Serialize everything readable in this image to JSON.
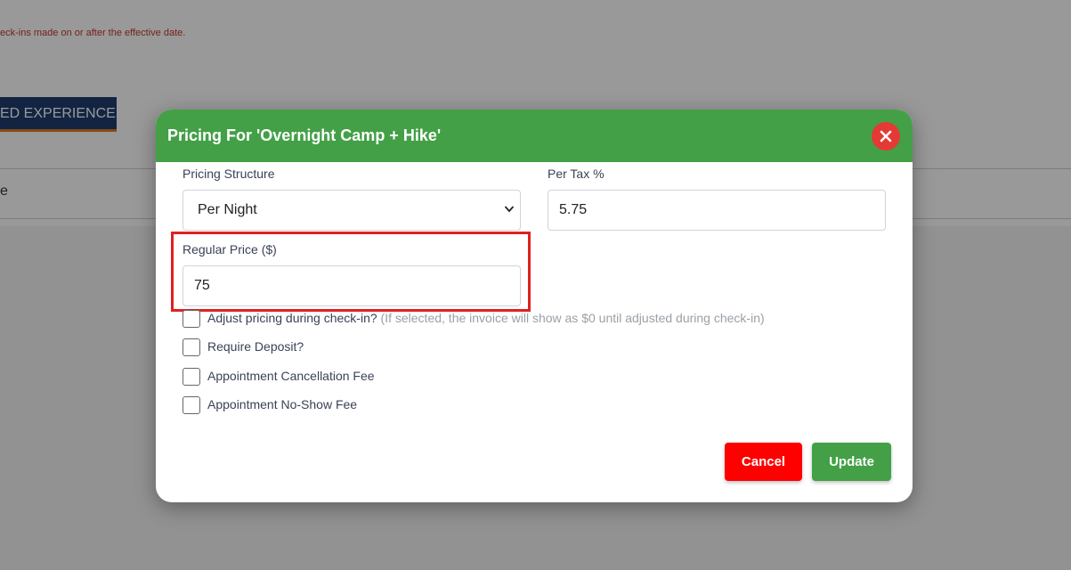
{
  "background": {
    "notice": "eck-ins made on or after the effective date.",
    "tab_label": "ED EXPERIENCES",
    "row_text": "e"
  },
  "modal": {
    "title": "Pricing For 'Overnight Camp + Hike'",
    "pricing_structure": {
      "label": "Pricing Structure",
      "selected": "Per Night"
    },
    "per_tax": {
      "label": "Per Tax %",
      "value": "5.75"
    },
    "regular_price": {
      "label": "Regular Price ($)",
      "value": "75"
    },
    "checkboxes": [
      {
        "label": "Adjust pricing during check-in?",
        "note": " (If selected, the invoice will show as $0 until adjusted during check-in)",
        "checked": false
      },
      {
        "label": "Require Deposit?",
        "checked": false
      },
      {
        "label": "Appointment Cancellation Fee",
        "checked": false
      },
      {
        "label": "Appointment No-Show Fee",
        "checked": false
      }
    ],
    "cancel_label": "Cancel",
    "update_label": "Update"
  },
  "colors": {
    "header_green": "#43a047",
    "close_red": "#e53935",
    "cancel_red": "#ff0000",
    "highlight_red": "#e02020",
    "tab_navy": "#1f3d6e"
  },
  "icons": {
    "close": "close-icon",
    "select_arrow": "chevron-down-icon"
  }
}
